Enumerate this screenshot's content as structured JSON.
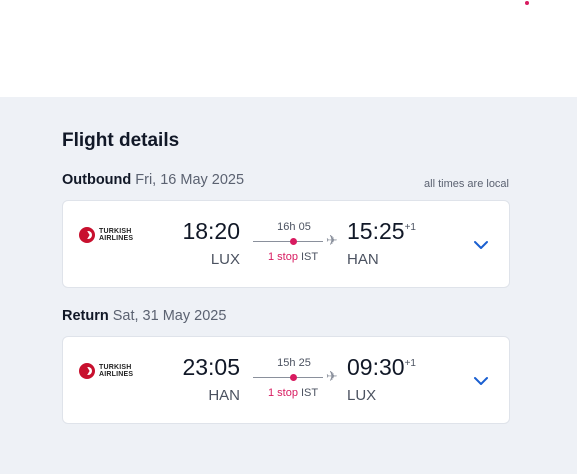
{
  "title": "Flight details",
  "local_note": "all times are local",
  "colors": {
    "accent": "#d81b60",
    "link": "#1a5fd0",
    "panel_bg": "#eef1f6"
  },
  "outbound": {
    "label": "Outbound",
    "date": "Fri, 16 May 2025",
    "airline": {
      "line1": "TURKISH",
      "line2": "AIRLINES",
      "icon": "turkish-airlines-logo-icon"
    },
    "dep_time": "18:20",
    "dep_code": "LUX",
    "duration": "16h 05",
    "stops": "1 stop",
    "via": "IST",
    "arr_time": "15:25",
    "arr_offset": "+1",
    "arr_code": "HAN"
  },
  "return": {
    "label": "Return",
    "date": "Sat, 31 May 2025",
    "airline": {
      "line1": "TURKISH",
      "line2": "AIRLINES",
      "icon": "turkish-airlines-logo-icon"
    },
    "dep_time": "23:05",
    "dep_code": "HAN",
    "duration": "15h 25",
    "stops": "1 stop",
    "via": "IST",
    "arr_time": "09:30",
    "arr_offset": "+1",
    "arr_code": "LUX"
  }
}
